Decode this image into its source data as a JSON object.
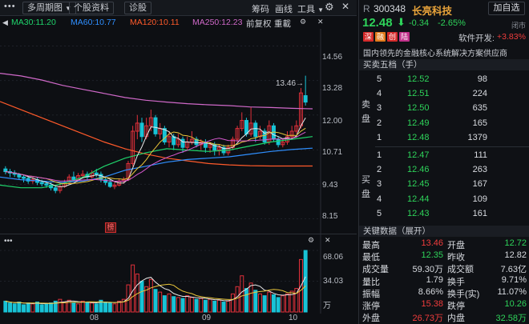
{
  "toolbar": {
    "more_label": "•••",
    "period_label": "多周期图",
    "stock_info_label": "个股资料",
    "diagnose_label": "诊股",
    "chip_label": "筹码",
    "draw_label": "画线",
    "tools_label": "工具"
  },
  "ma_legend": {
    "ma30": "MA30:11.20",
    "ma60": "MA60:10.77",
    "ma120": "MA120:10.11",
    "ma250": "MA250:12.23",
    "adjust_label": "前复权",
    "overlay_label": "重載"
  },
  "price_axis": [
    "14.56",
    "13.28",
    "12.00",
    "10.71",
    "9.43",
    "8.15"
  ],
  "volume_axis": [
    "68.06",
    "34.03",
    "万"
  ],
  "date_axis": [
    "08",
    "09",
    "10"
  ],
  "high_marker": "13.46→",
  "badge_label": "榜",
  "colors": {
    "up": "#f03c3c",
    "down": "#2ed35a",
    "up_candle": "#e0303a",
    "down_candle": "#18c3d6",
    "ma30": "#1fd36b",
    "ma60": "#2f8fff",
    "ma120": "#ff5a2a",
    "ma250": "#d069c9",
    "name": "#e8a33a"
  },
  "header": {
    "market_tag": "R",
    "code": "300348",
    "name": "长亮科技",
    "add_favorite": "加自选",
    "price": "12.48",
    "change": "-0.34",
    "change_pct": "-2.65%",
    "close_status": "闭市",
    "sector_label": "软件开发:",
    "sector_change": "+3.83%",
    "badges": [
      "深",
      "融",
      "创",
      "陆"
    ],
    "description": "国内领先的金融核心系统解决方案供应商"
  },
  "order_book": {
    "title": "买卖五档（手）",
    "sell_label_1": "卖",
    "sell_label_2": "盘",
    "buy_label_1": "买",
    "buy_label_2": "盘",
    "sells": [
      {
        "level": "5",
        "price": "12.52",
        "vol": "98"
      },
      {
        "level": "4",
        "price": "12.51",
        "vol": "224"
      },
      {
        "level": "3",
        "price": "12.50",
        "vol": "635"
      },
      {
        "level": "2",
        "price": "12.49",
        "vol": "165"
      },
      {
        "level": "1",
        "price": "12.48",
        "vol": "1379"
      }
    ],
    "buys": [
      {
        "level": "1",
        "price": "12.47",
        "vol": "111"
      },
      {
        "level": "2",
        "price": "12.46",
        "vol": "263"
      },
      {
        "level": "3",
        "price": "12.45",
        "vol": "167"
      },
      {
        "level": "4",
        "price": "12.44",
        "vol": "109"
      },
      {
        "level": "5",
        "price": "12.43",
        "vol": "161"
      }
    ]
  },
  "key_data": {
    "title": "关键数据（展开）",
    "rows": [
      {
        "l1": "最高",
        "v1": "13.46",
        "c1": "red",
        "l2": "开盘",
        "v2": "12.72",
        "c2": "green"
      },
      {
        "l1": "最低",
        "v1": "12.35",
        "c1": "green",
        "l2": "昨收",
        "v2": "12.82",
        "c2": "white"
      },
      {
        "l1": "成交量",
        "v1": "59.30万",
        "c1": "white",
        "l2": "成交额",
        "v2": "7.63亿",
        "c2": "white"
      },
      {
        "l1": "量比",
        "v1": "1.79",
        "c1": "white",
        "l2": "换手",
        "v2": "9.71%",
        "c2": "white"
      },
      {
        "l1": "振幅",
        "v1": "8.66%",
        "c1": "white",
        "l2": "换手(实)",
        "v2": "11.07%",
        "c2": "white"
      },
      {
        "l1": "涨停",
        "v1": "15.38",
        "c1": "red",
        "l2": "跌停",
        "v2": "10.26",
        "c2": "green"
      },
      {
        "l1": "外盘",
        "v1": "26.73万",
        "c1": "red",
        "l2": "内盘",
        "v2": "32.58万",
        "c2": "green"
      }
    ]
  },
  "chart_data": {
    "type": "candlestick",
    "price_range": [
      8.15,
      14.56
    ],
    "candles": [
      [
        10.0,
        9.9,
        10.1,
        9.8
      ],
      [
        9.9,
        9.85,
        10.0,
        9.7
      ],
      [
        9.85,
        9.8,
        9.95,
        9.7
      ],
      [
        9.8,
        9.7,
        9.85,
        9.6
      ],
      [
        9.7,
        9.65,
        9.8,
        9.5
      ],
      [
        9.65,
        9.55,
        9.75,
        9.45
      ],
      [
        9.55,
        9.6,
        9.7,
        9.45
      ],
      [
        9.6,
        9.5,
        9.7,
        9.4
      ],
      [
        9.5,
        9.45,
        9.6,
        9.35
      ],
      [
        9.45,
        9.4,
        9.55,
        9.3
      ],
      [
        9.4,
        9.3,
        9.5,
        9.2
      ],
      [
        9.3,
        9.2,
        9.4,
        9.1
      ],
      [
        9.2,
        9.35,
        9.45,
        9.1
      ],
      [
        9.35,
        9.5,
        9.6,
        9.3
      ],
      [
        9.5,
        9.7,
        9.8,
        9.45
      ],
      [
        9.7,
        9.6,
        9.9,
        9.55
      ],
      [
        9.6,
        9.75,
        9.85,
        9.55
      ],
      [
        9.75,
        9.8,
        9.95,
        9.65
      ],
      [
        9.8,
        9.7,
        9.9,
        9.6
      ],
      [
        9.7,
        9.85,
        9.95,
        9.65
      ],
      [
        9.85,
        9.8,
        10.0,
        9.7
      ],
      [
        9.8,
        9.6,
        9.9,
        9.5
      ],
      [
        9.6,
        9.5,
        9.7,
        9.4
      ],
      [
        9.5,
        9.35,
        9.6,
        9.3
      ],
      [
        9.35,
        9.4,
        9.5,
        9.25
      ],
      [
        9.4,
        9.55,
        9.65,
        9.35
      ],
      [
        9.55,
        9.6,
        9.7,
        9.45
      ],
      [
        9.6,
        10.2,
        10.3,
        9.55
      ],
      [
        10.2,
        11.4,
        11.6,
        10.1
      ],
      [
        11.4,
        11.7,
        12.0,
        11.1
      ],
      [
        11.7,
        11.2,
        11.9,
        11.0
      ],
      [
        11.2,
        11.6,
        11.9,
        11.1
      ],
      [
        11.6,
        11.9,
        12.2,
        11.4
      ],
      [
        11.9,
        11.3,
        12.0,
        11.2
      ],
      [
        11.3,
        11.5,
        11.7,
        11.1
      ],
      [
        11.5,
        11.0,
        11.6,
        10.9
      ],
      [
        11.0,
        11.2,
        11.4,
        10.8
      ],
      [
        11.2,
        10.9,
        11.3,
        10.7
      ],
      [
        10.9,
        11.1,
        11.3,
        10.8
      ],
      [
        11.1,
        10.8,
        11.2,
        10.6
      ],
      [
        10.8,
        11.0,
        11.2,
        10.7
      ],
      [
        11.0,
        11.1,
        11.4,
        10.9
      ],
      [
        11.1,
        10.9,
        11.2,
        10.8
      ],
      [
        10.9,
        11.0,
        11.1,
        10.7
      ],
      [
        11.0,
        10.8,
        11.1,
        10.6
      ],
      [
        10.8,
        10.9,
        11.0,
        10.6
      ],
      [
        10.9,
        10.7,
        11.0,
        10.5
      ],
      [
        10.7,
        10.8,
        10.9,
        10.5
      ],
      [
        10.8,
        10.6,
        10.9,
        10.5
      ],
      [
        10.6,
        10.8,
        10.9,
        10.5
      ],
      [
        10.8,
        11.1,
        11.2,
        10.7
      ],
      [
        11.1,
        11.5,
        11.6,
        11.0
      ],
      [
        11.5,
        11.8,
        12.1,
        11.4
      ],
      [
        11.8,
        11.3,
        11.9,
        11.2
      ],
      [
        11.3,
        11.7,
        12.3,
        11.2
      ],
      [
        11.7,
        11.2,
        11.8,
        11.0
      ],
      [
        11.2,
        11.4,
        11.6,
        11.1
      ],
      [
        11.4,
        11.0,
        11.5,
        10.9
      ],
      [
        11.0,
        11.6,
        11.8,
        10.9
      ],
      [
        11.6,
        11.1,
        11.7,
        11.0
      ],
      [
        11.1,
        10.9,
        11.2,
        10.8
      ],
      [
        10.9,
        11.0,
        11.1,
        10.8
      ],
      [
        11.0,
        11.2,
        11.4,
        10.9
      ],
      [
        11.2,
        11.4,
        11.6,
        11.1
      ],
      [
        11.4,
        11.6,
        11.8,
        11.3
      ],
      [
        11.6,
        12.82,
        13.0,
        11.5
      ],
      [
        12.72,
        12.48,
        13.46,
        12.35
      ]
    ],
    "ma250": [
      13.55,
      13.45,
      13.3,
      13.1,
      12.95,
      12.8,
      12.65,
      12.55,
      12.48,
      12.42,
      12.38,
      12.35,
      12.3,
      12.28,
      12.25,
      12.23
    ],
    "ma120": [
      12.5,
      12.2,
      11.9,
      11.6,
      11.3,
      11.0,
      10.75,
      10.55,
      10.4,
      10.3,
      10.2,
      10.15,
      10.12,
      10.11,
      10.11,
      10.11
    ],
    "ma60": [
      9.7,
      9.6,
      9.55,
      9.5,
      9.55,
      9.7,
      9.95,
      10.1,
      10.25,
      10.35,
      10.4,
      10.45,
      10.55,
      10.65,
      10.72,
      10.77
    ],
    "ma30": [
      9.4,
      9.3,
      9.3,
      9.45,
      9.7,
      10.1,
      10.4,
      10.6,
      10.75,
      10.7,
      10.65,
      10.7,
      10.85,
      11.0,
      11.1,
      11.2
    ],
    "volume_max": 68.06,
    "volume_unit": "万",
    "volumes": [
      12,
      10,
      9,
      11,
      8,
      10,
      9,
      11,
      8,
      9,
      10,
      12,
      14,
      11,
      13,
      10,
      9,
      12,
      11,
      10,
      9,
      13,
      11,
      10,
      9,
      12,
      14,
      30,
      52,
      42,
      34,
      28,
      36,
      25,
      22,
      18,
      20,
      17,
      16,
      15,
      18,
      16,
      14,
      15,
      13,
      14,
      12,
      13,
      11,
      12,
      20,
      28,
      40,
      26,
      32,
      24,
      20,
      18,
      22,
      19,
      16,
      18,
      20,
      23,
      26,
      58,
      68
    ]
  }
}
